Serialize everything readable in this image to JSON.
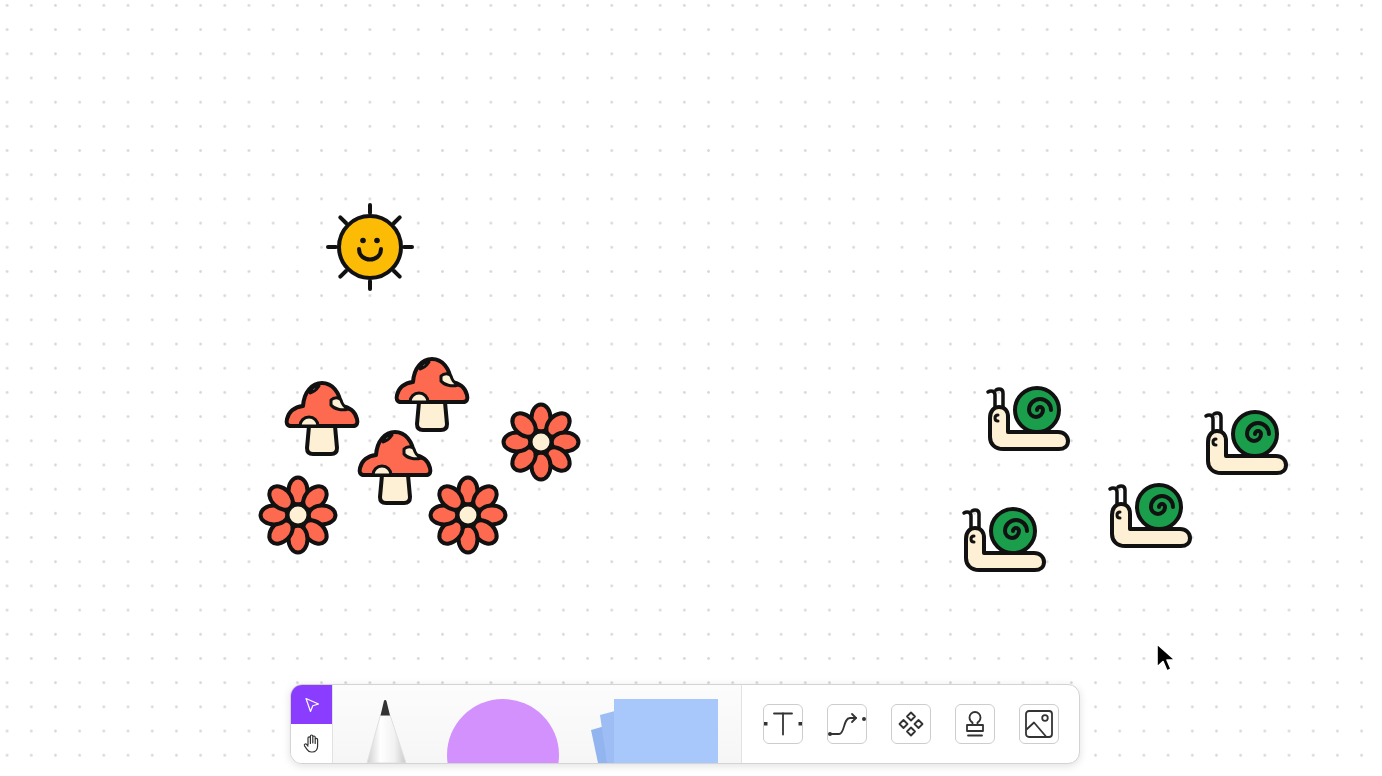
{
  "canvas": {
    "stickers": [
      {
        "kind": "sun"
      },
      {
        "kind": "mushroom"
      },
      {
        "kind": "mushroom"
      },
      {
        "kind": "flower"
      },
      {
        "kind": "mushroom"
      },
      {
        "kind": "flower"
      },
      {
        "kind": "flower"
      },
      {
        "kind": "snail"
      },
      {
        "kind": "snail"
      },
      {
        "kind": "snail"
      },
      {
        "kind": "snail"
      }
    ]
  },
  "toolbar": {
    "mode_tools": [
      {
        "kind": "select",
        "selected": true
      },
      {
        "kind": "hand",
        "selected": false
      }
    ],
    "creation_tools": [
      {
        "kind": "pen"
      },
      {
        "kind": "shape"
      },
      {
        "kind": "sticky_notes"
      }
    ],
    "insert_tools": [
      {
        "kind": "text"
      },
      {
        "kind": "connector"
      },
      {
        "kind": "components"
      },
      {
        "kind": "stamp"
      },
      {
        "kind": "image"
      }
    ]
  }
}
